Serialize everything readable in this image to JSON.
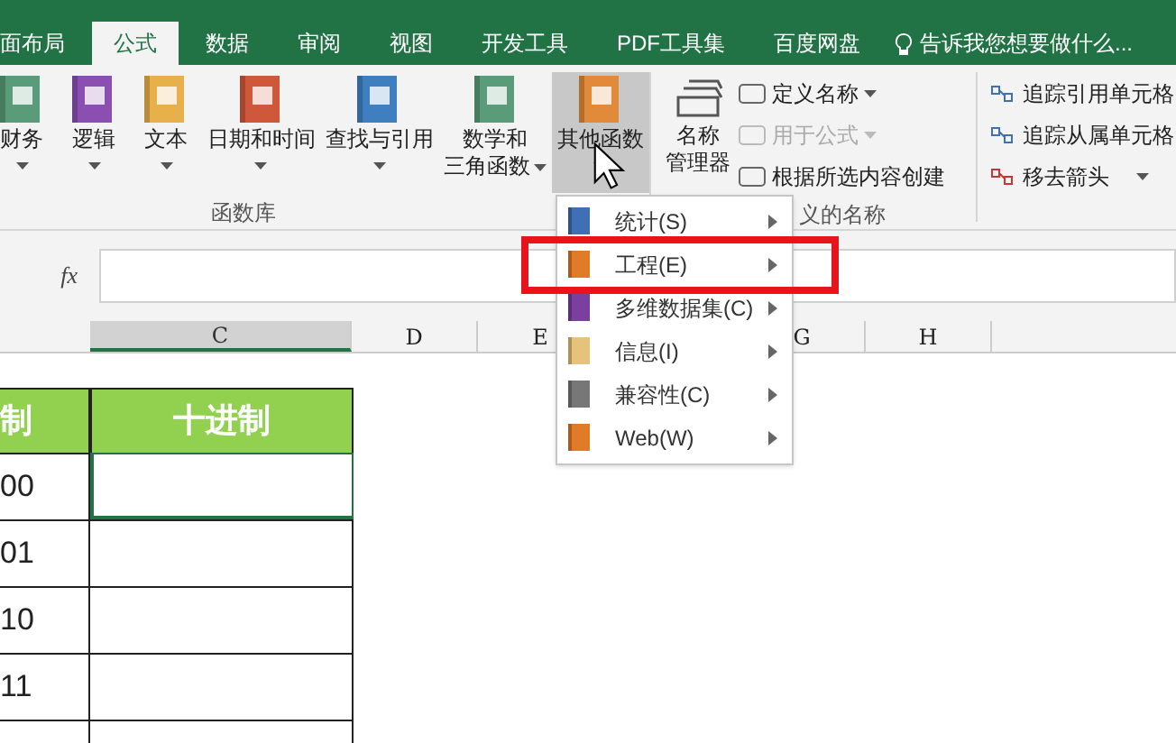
{
  "tabs": [
    {
      "label": "面布局",
      "selected": false
    },
    {
      "label": "公式",
      "selected": true
    },
    {
      "label": "数据",
      "selected": false
    },
    {
      "label": "审阅",
      "selected": false
    },
    {
      "label": "视图",
      "selected": false
    },
    {
      "label": "开发工具",
      "selected": false
    },
    {
      "label": "PDF工具集",
      "selected": false
    },
    {
      "label": "百度网盘",
      "selected": false
    }
  ],
  "tell_me": {
    "placeholder": "告诉我您想要做什么..."
  },
  "function_library": {
    "label": "函数库",
    "buttons": [
      {
        "lines": [
          "财务"
        ],
        "color": "#5a9b7a",
        "dropdown": true,
        "active": false
      },
      {
        "lines": [
          "逻辑"
        ],
        "color": "#8a4fb0",
        "dropdown": true,
        "active": false
      },
      {
        "lines": [
          "文本"
        ],
        "color": "#e8b04a",
        "dropdown": true,
        "active": false
      },
      {
        "lines": [
          "日期和时间"
        ],
        "color": "#d0583a",
        "dropdown": true,
        "active": false
      },
      {
        "lines": [
          "查找与引用"
        ],
        "color": "#3f7fc0",
        "dropdown": true,
        "active": false
      },
      {
        "lines": [
          "数学和",
          "三角函数"
        ],
        "color": "#5a9b7a",
        "dropdown": true,
        "active": false
      },
      {
        "lines": [
          "其他函数"
        ],
        "color": "#e08a3a",
        "dropdown": true,
        "active": true
      }
    ]
  },
  "defined_names": {
    "label": "义的名称",
    "manager": [
      "名称",
      "管理器"
    ],
    "items": [
      {
        "label": "定义名称",
        "dropdown": true,
        "disabled": false
      },
      {
        "label": "用于公式",
        "dropdown": true,
        "disabled": true
      },
      {
        "label": "根据所选内容创建",
        "dropdown": false,
        "disabled": false
      }
    ]
  },
  "auditing": {
    "items": [
      {
        "label": "追踪引用单元格",
        "dropdown": false
      },
      {
        "label": "追踪从属单元格",
        "dropdown": false
      },
      {
        "label": "移去箭头",
        "dropdown": true
      }
    ]
  },
  "formula_bar": {
    "fx": "fx"
  },
  "columns": [
    {
      "label": "C",
      "selected": true
    },
    {
      "label": "D",
      "selected": false
    },
    {
      "label": "E",
      "selected": false
    },
    {
      "label": "G",
      "selected": false
    },
    {
      "label": "H",
      "selected": false
    }
  ],
  "table": {
    "header": [
      "制",
      "十进制"
    ],
    "rows": [
      [
        "00",
        ""
      ],
      [
        "01",
        ""
      ],
      [
        "10",
        ""
      ],
      [
        "11",
        ""
      ]
    ]
  },
  "menu": {
    "items": [
      {
        "label": "统计(S)",
        "color": "#3f6fb5",
        "highlighted": false
      },
      {
        "label": "工程(E)",
        "color": "#e07b28",
        "highlighted": true
      },
      {
        "label": "多维数据集(C)",
        "color": "#7b3fa0",
        "highlighted": false
      },
      {
        "label": "信息(I)",
        "color": "#e6c27a",
        "highlighted": false
      },
      {
        "label": "兼容性(C)",
        "color": "#777777",
        "highlighted": false
      },
      {
        "label": "Web(W)",
        "color": "#e07b28",
        "highlighted": false
      }
    ]
  }
}
